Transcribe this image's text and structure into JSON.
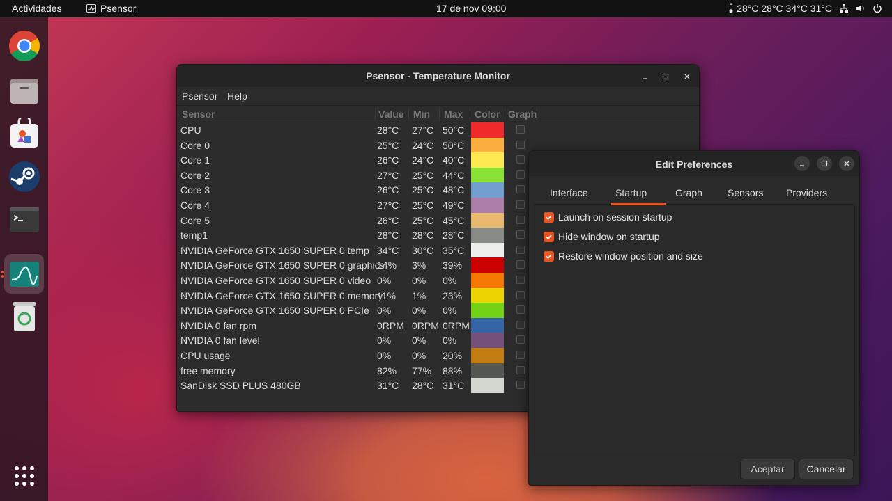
{
  "topbar": {
    "activities": "Actividades",
    "app_name": "Psensor",
    "clock": "17 de nov  09:00",
    "temps": "28°C 28°C 34°C 31°C"
  },
  "dock": {
    "items": [
      "chrome-icon",
      "files-icon",
      "software-icon",
      "steam-icon",
      "terminal-icon",
      "psensor-icon",
      "trash-icon",
      "show-apps-icon"
    ]
  },
  "psensor": {
    "title": "Psensor - Temperature Monitor",
    "menu": [
      "Psensor",
      "Help"
    ],
    "columns": [
      "Sensor",
      "Value",
      "Min",
      "Max",
      "Color",
      "Graph"
    ],
    "rows": [
      {
        "name": "CPU",
        "value": "28°C",
        "min": "27°C",
        "max": "50°C",
        "color": "#ef2929"
      },
      {
        "name": "Core 0",
        "value": "25°C",
        "min": "24°C",
        "max": "50°C",
        "color": "#fcaf3e"
      },
      {
        "name": "Core 1",
        "value": "26°C",
        "min": "24°C",
        "max": "40°C",
        "color": "#fce94f"
      },
      {
        "name": "Core 2",
        "value": "27°C",
        "min": "25°C",
        "max": "44°C",
        "color": "#8ae234"
      },
      {
        "name": "Core 3",
        "value": "26°C",
        "min": "25°C",
        "max": "48°C",
        "color": "#729fcf"
      },
      {
        "name": "Core 4",
        "value": "27°C",
        "min": "25°C",
        "max": "49°C",
        "color": "#ad7fa8"
      },
      {
        "name": "Core 5",
        "value": "26°C",
        "min": "25°C",
        "max": "45°C",
        "color": "#e9b96e"
      },
      {
        "name": "temp1",
        "value": "28°C",
        "min": "28°C",
        "max": "28°C",
        "color": "#888a85"
      },
      {
        "name": "NVIDIA GeForce GTX 1650 SUPER 0 temp",
        "value": "34°C",
        "min": "30°C",
        "max": "35°C",
        "color": "#eeeeec"
      },
      {
        "name": "NVIDIA GeForce GTX 1650 SUPER 0 graphics",
        "value": "14%",
        "min": "3%",
        "max": "39%",
        "color": "#cc0000"
      },
      {
        "name": "NVIDIA GeForce GTX 1650 SUPER 0 video",
        "value": "0%",
        "min": "0%",
        "max": "0%",
        "color": "#f57900"
      },
      {
        "name": "NVIDIA GeForce GTX 1650 SUPER 0 memory",
        "value": "11%",
        "min": "1%",
        "max": "23%",
        "color": "#edd400"
      },
      {
        "name": "NVIDIA GeForce GTX 1650 SUPER 0 PCIe",
        "value": "0%",
        "min": "0%",
        "max": "0%",
        "color": "#73d216"
      },
      {
        "name": "NVIDIA 0 fan rpm",
        "value": "0RPM",
        "min": "0RPM",
        "max": "0RPM",
        "color": "#3465a4"
      },
      {
        "name": "NVIDIA 0 fan level",
        "value": "0%",
        "min": "0%",
        "max": "0%",
        "color": "#75507b"
      },
      {
        "name": "CPU usage",
        "value": "0%",
        "min": "0%",
        "max": "20%",
        "color": "#c17d11"
      },
      {
        "name": "free memory",
        "value": "82%",
        "min": "77%",
        "max": "88%",
        "color": "#555753"
      },
      {
        "name": "SanDisk SSD PLUS 480GB",
        "value": "31°C",
        "min": "28°C",
        "max": "31°C",
        "color": "#d3d7cf"
      }
    ]
  },
  "prefs": {
    "title": "Edit Preferences",
    "tabs": [
      "Interface",
      "Startup",
      "Graph",
      "Sensors",
      "Providers"
    ],
    "active_tab": "Startup",
    "options": [
      {
        "label": "Launch on session startup",
        "checked": true
      },
      {
        "label": "Hide window on startup",
        "checked": true
      },
      {
        "label": "Restore window position and size",
        "checked": true
      }
    ],
    "accept": "Aceptar",
    "cancel": "Cancelar"
  },
  "colors": {
    "accent": "#e95420",
    "window_bg": "#2c2c2c",
    "titlebar_bg": "#242424"
  }
}
